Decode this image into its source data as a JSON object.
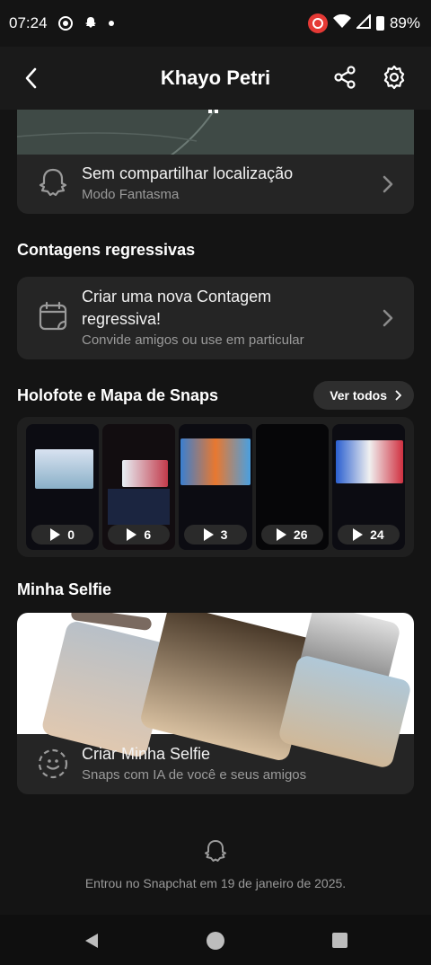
{
  "status_bar": {
    "time": "07:24",
    "battery": "89%"
  },
  "header": {
    "title": "Khayo Petri"
  },
  "location": {
    "title": "Sem compartilhar localização",
    "subtitle": "Modo Fantasma"
  },
  "countdowns": {
    "section_title": "Contagens regressivas",
    "title": "Criar uma nova Contagem regressiva!",
    "subtitle": "Convide amigos ou use em particular"
  },
  "spotlight": {
    "section_title": "Holofote e Mapa de Snaps",
    "see_all": "Ver todos",
    "items": [
      {
        "views": "0"
      },
      {
        "views": "6"
      },
      {
        "views": "3"
      },
      {
        "views": "26"
      },
      {
        "views": "24"
      }
    ]
  },
  "selfie": {
    "section_title": "Minha Selfie",
    "title": "Criar Minha Selfie",
    "subtitle": "Snaps com IA de você e seus amigos"
  },
  "footer": {
    "joined": "Entrou no Snapchat em 19 de janeiro de 2025."
  },
  "colors": {
    "background": "#141414",
    "card": "#252525",
    "muted_text": "#9a9a9a",
    "recording_red": "#e53935"
  }
}
